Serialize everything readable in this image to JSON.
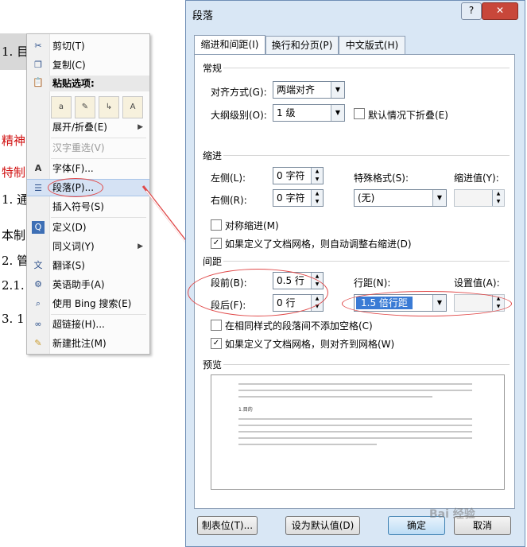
{
  "document": {
    "lines": [
      {
        "text": "1. 目",
        "red": false
      },
      {
        "text": "精神",
        "red": true
      },
      {
        "text": "特制",
        "red": true
      },
      {
        "text": "1. 通",
        "red": false
      },
      {
        "text": "本制",
        "red": false
      },
      {
        "text": "2. 管",
        "red": false
      },
      {
        "text": "2.1. 1",
        "red": false
      },
      {
        "text": "3. 1",
        "red": false
      }
    ]
  },
  "context_menu": {
    "cut": "剪切(T)",
    "copy": "复制(C)",
    "paste_options": "粘贴选项:",
    "expand": "展开/折叠(E)",
    "reconvert": "汉字重选(V)",
    "font": "字体(F)...",
    "paragraph": "段落(P)...",
    "insert_symbol": "插入符号(S)",
    "define": "定义(D)",
    "synonyms": "同义词(Y)",
    "translate": "翻译(S)",
    "english_assistant": "英语助手(A)",
    "bing_search": "使用 Bing 搜索(E)",
    "hyperlink": "超链接(H)...",
    "new_comment": "新建批注(M)"
  },
  "dialog": {
    "title": "段落",
    "help": "?",
    "close": "✕",
    "tabs": [
      "缩进和间距(I)",
      "换行和分页(P)",
      "中文版式(H)"
    ],
    "general": {
      "header": "常规",
      "alignment_label": "对齐方式(G):",
      "alignment_value": "两端对齐",
      "outline_label": "大纲级别(O):",
      "outline_value": "1 级",
      "collapsed_label": "默认情况下折叠(E)"
    },
    "indent": {
      "header": "缩进",
      "left_label": "左侧(L):",
      "left_value": "0 字符",
      "right_label": "右侧(R):",
      "right_value": "0 字符",
      "special_label": "特殊格式(S):",
      "special_value": "(无)",
      "by_label": "缩进值(Y):",
      "mirror_label": "对称缩进(M)",
      "auto_adjust_label": "如果定义了文档网格，则自动调整右缩进(D)"
    },
    "spacing": {
      "header": "间距",
      "before_label": "段前(B):",
      "before_value": "0.5 行",
      "after_label": "段后(F):",
      "after_value": "0 行",
      "line_spacing_label": "行距(N):",
      "line_spacing_value": "1.5 倍行距",
      "at_label": "设置值(A):",
      "no_space_label": "在相同样式的段落间不添加空格(C)",
      "snap_grid_label": "如果定义了文档网格，则对齐到网格(W)"
    },
    "preview": {
      "header": "预览",
      "sample": "1.目的"
    },
    "buttons": {
      "tabs": "制表位(T)...",
      "set_default": "设为默认值(D)",
      "ok": "确定",
      "cancel": "取消"
    }
  },
  "watermark": "Bai 经验",
  "colors": {
    "highlight_oval": "#e04a4a",
    "selection": "#3a7bd5",
    "dialog_frame": "#d9e7f5"
  }
}
